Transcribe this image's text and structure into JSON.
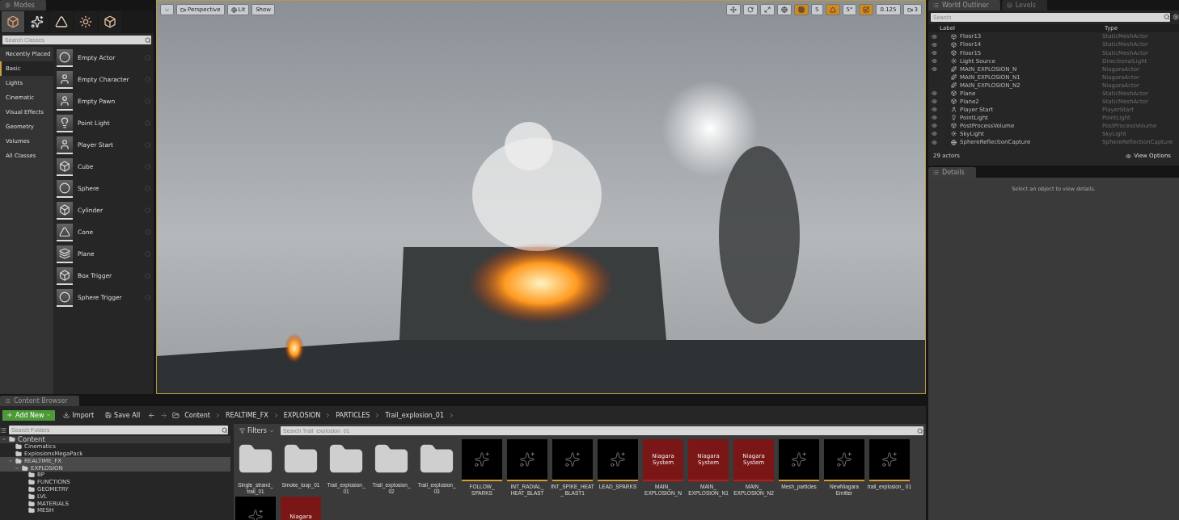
{
  "modes_panel": {
    "tab": "Modes",
    "mode_tabs": [
      {
        "selected": true
      },
      {
        "selected": false
      },
      {
        "selected": false
      },
      {
        "selected": false
      },
      {
        "selected": false
      }
    ],
    "search": {
      "placeholder": "Search Classes"
    },
    "categories": [
      {
        "label": "Recently Placed",
        "selected": false
      },
      {
        "label": "Basic",
        "selected": true
      },
      {
        "label": "Lights",
        "selected": false
      },
      {
        "label": "Cinematic",
        "selected": false
      },
      {
        "label": "Visual Effects",
        "selected": false
      },
      {
        "label": "Geometry",
        "selected": false
      },
      {
        "label": "Volumes",
        "selected": false
      },
      {
        "label": "All Classes",
        "selected": false
      }
    ],
    "items": [
      {
        "name": "Empty Actor",
        "kind": "sphere"
      },
      {
        "name": "Empty Character",
        "kind": "capsule"
      },
      {
        "name": "Empty Pawn",
        "kind": "pawn"
      },
      {
        "name": "Point Light",
        "kind": "bulb"
      },
      {
        "name": "Player Start",
        "kind": "player"
      },
      {
        "name": "Cube",
        "kind": "cube"
      },
      {
        "name": "Sphere",
        "kind": "sphere"
      },
      {
        "name": "Cylinder",
        "kind": "cylinder"
      },
      {
        "name": "Cone",
        "kind": "cone"
      },
      {
        "name": "Plane",
        "kind": "plane"
      },
      {
        "name": "Box Trigger",
        "kind": "cube"
      },
      {
        "name": "Sphere Trigger",
        "kind": "sphere"
      }
    ]
  },
  "viewport": {
    "view_mode": "Perspective",
    "lighting": "Lit",
    "show": "Show",
    "grid_snap": {
      "on": true,
      "value": "5"
    },
    "rotation_snap": {
      "on": true,
      "value": "5°"
    },
    "scale_snap": {
      "on": true,
      "value": "0.125"
    },
    "camera_speed": "3"
  },
  "world_outliner": {
    "tabs": [
      {
        "label": "World Outliner",
        "selected": true
      },
      {
        "label": "Levels",
        "selected": false
      }
    ],
    "search": {
      "placeholder": "Search"
    },
    "columns": [
      "Label",
      "Type"
    ],
    "rows": [
      {
        "label": "Floor13",
        "type": "StaticMeshActor",
        "kind": "mesh",
        "visible": true
      },
      {
        "label": "Floor14",
        "type": "StaticMeshActor",
        "kind": "mesh",
        "visible": true
      },
      {
        "label": "Floor15",
        "type": "StaticMeshActor",
        "kind": "mesh",
        "visible": true
      },
      {
        "label": "Light Source",
        "type": "DirectionalLight",
        "kind": "light",
        "visible": true
      },
      {
        "label": "MAIN_EXPLOSION_N",
        "type": "NiagaraActor",
        "kind": "niagara",
        "visible": true
      },
      {
        "label": "MAIN_EXPLOSION_N1",
        "type": "NiagaraActor",
        "kind": "niagara",
        "visible": false
      },
      {
        "label": "MAIN_EXPLOSION_N2",
        "type": "NiagaraActor",
        "kind": "niagara",
        "visible": false
      },
      {
        "label": "Plane",
        "type": "StaticMeshActor",
        "kind": "mesh",
        "visible": true
      },
      {
        "label": "Plane2",
        "type": "StaticMeshActor",
        "kind": "mesh",
        "visible": true
      },
      {
        "label": "Player Start",
        "type": "PlayerStart",
        "kind": "player",
        "visible": true
      },
      {
        "label": "PointLight",
        "type": "PointLight",
        "kind": "bulb",
        "visible": true
      },
      {
        "label": "PostProcessVolume",
        "type": "PostProcessVolume",
        "kind": "volume",
        "visible": true
      },
      {
        "label": "SkyLight",
        "type": "SkyLight",
        "kind": "light",
        "visible": true
      },
      {
        "label": "SphereReflectionCapture",
        "type": "SphereReflectionCapture",
        "kind": "capture",
        "visible": true
      }
    ],
    "count": "29 actors",
    "view_options": "View Options"
  },
  "details": {
    "tab": "Details",
    "message": "Select an object to view details."
  },
  "content_browser": {
    "tab": "Content Browser",
    "add_new": "Add New",
    "import": "Import",
    "save_all": "Save All",
    "path": [
      "Content",
      "REALTIME_FX",
      "EXPLOSION",
      "PARTICLES",
      "Trail_explosion_01"
    ],
    "folder_search": {
      "placeholder": "Search Folders"
    },
    "filters": "Filters",
    "asset_search": {
      "placeholder": "Search Trail_explosion_01"
    },
    "tree": [
      {
        "label": "Content",
        "expanded": true,
        "selected": false,
        "children": [
          {
            "label": "Cinematics",
            "expanded": false,
            "selected": false
          },
          {
            "label": "ExplosionsMegaPack",
            "expanded": false,
            "selected": false
          },
          {
            "label": "REALTIME_FX",
            "expanded": true,
            "selected": true,
            "children": [
              {
                "label": "EXPLOSION",
                "expanded": true,
                "selected": true,
                "children": [
                  {
                    "label": "BP",
                    "expanded": false,
                    "selected": false
                  },
                  {
                    "label": "FUNCTIONS",
                    "expanded": false,
                    "selected": false
                  },
                  {
                    "label": "GEOMETRY",
                    "expanded": false,
                    "selected": false
                  },
                  {
                    "label": "LVL",
                    "expanded": false,
                    "selected": false
                  },
                  {
                    "label": "MATERIALS",
                    "expanded": false,
                    "selected": false
                  },
                  {
                    "label": "MESH",
                    "expanded": false,
                    "selected": false
                  }
                ]
              }
            ]
          }
        ]
      }
    ],
    "assets": [
      {
        "kind": "folder",
        "label": "Single_strand_ trail_01"
      },
      {
        "kind": "folder",
        "label": "Smoke_loop_01"
      },
      {
        "kind": "folder",
        "label": "Trail_explosion_ 01"
      },
      {
        "kind": "folder",
        "label": "Trail_explosion_ 02"
      },
      {
        "kind": "folder",
        "label": "Trail_explosion_ 03"
      },
      {
        "kind": "emitter",
        "label": "FOLLOW_ SPARKS"
      },
      {
        "kind": "emitter",
        "label": "INT_RADIAL_ HEAT_BLAST"
      },
      {
        "kind": "emitter",
        "label": "INT_SPIKE_HEAT_ BLAST1"
      },
      {
        "kind": "emitter",
        "label": "LEAD_SPARKS"
      },
      {
        "kind": "system",
        "thumb": "Niagara System",
        "label": "MAIN_ EXPLOSION_N"
      },
      {
        "kind": "system",
        "thumb": "Niagara System",
        "label": "MAIN_ EXPLOSION_N1"
      },
      {
        "kind": "system",
        "thumb": "Niagara System",
        "label": "MAIN_ EXPLOSION_N2"
      },
      {
        "kind": "emitter",
        "label": "Mesh_particles"
      },
      {
        "kind": "emitter",
        "label": "NewNiagara Emitter"
      },
      {
        "kind": "emitter",
        "label": "trail_explosion_ 01"
      },
      {
        "kind": "emitter"
      },
      {
        "kind": "system",
        "thumb": "Niagara"
      }
    ]
  }
}
